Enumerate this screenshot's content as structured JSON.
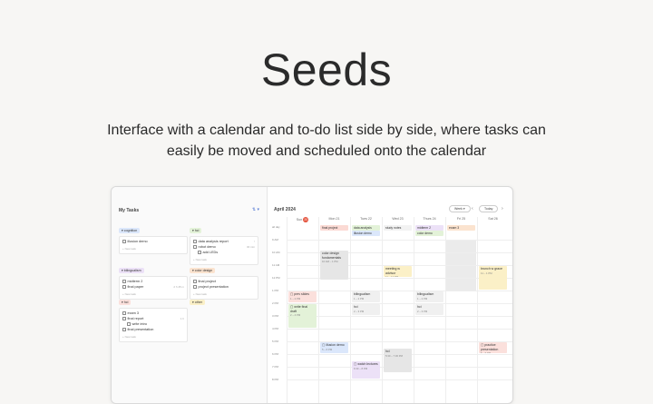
{
  "hero": {
    "title": "Seeds",
    "subtitle": "Interface with a calendar and to-do list side by side, where tasks can easily be moved and scheduled onto the calendar"
  },
  "tasks_panel": {
    "title": "My Tasks",
    "tools": "⇅ ▾",
    "new_task": "+ New task",
    "groups": [
      {
        "id": "cognition",
        "label": "▾ cognition",
        "color": "#dbe7fb",
        "tasks": [
          {
            "text": "illusion demo",
            "meta": "",
            "sub": false
          }
        ]
      },
      {
        "id": "hci",
        "label": "▾ hci",
        "color": "#e3f2d8",
        "tasks": [
          {
            "text": "data analysis report",
            "meta": "!",
            "sub": false
          },
          {
            "text": "robot demo",
            "meta": "30 min",
            "sub": false
          },
          {
            "text": "add LEDs",
            "meta": "",
            "sub": true
          }
        ]
      },
      {
        "id": "bilingualism",
        "label": "▾ bilingualism",
        "color": "#ece1f7",
        "tasks": [
          {
            "text": "midterm 2",
            "meta": "",
            "sub": false
          },
          {
            "text": "final paper",
            "meta": "2 h 45 m",
            "sub": false
          }
        ]
      },
      {
        "id": "color-design",
        "label": "▾ color design",
        "color": "#fbe3cf",
        "tasks": [
          {
            "text": "final project",
            "meta": "",
            "sub": false
          },
          {
            "text": "project presentation",
            "meta": "",
            "sub": false
          }
        ]
      },
      {
        "id": "hci2",
        "label": "▾ hci",
        "color": "#fbe0dc",
        "tasks": [
          {
            "text": "exam 3",
            "meta": "",
            "sub": false
          },
          {
            "text": "final report",
            "meta": "1 h",
            "sub": false
          },
          {
            "text": "write intro",
            "meta": "",
            "sub": true
          },
          {
            "text": "final presentation",
            "meta": "",
            "sub": false
          }
        ]
      },
      {
        "id": "other",
        "label": "▾ other",
        "color": "#fbf0c7",
        "tasks": []
      }
    ]
  },
  "calendar": {
    "month_title": "April 2024",
    "view_button": "Week ▾",
    "today_button": "Today",
    "nav_prev": "‹",
    "nav_next": "›",
    "days": [
      {
        "label": "Sun",
        "num": "20",
        "today": true
      },
      {
        "label": "Mon",
        "num": "21",
        "today": false
      },
      {
        "label": "Tues",
        "num": "22",
        "today": false
      },
      {
        "label": "Wed",
        "num": "23",
        "today": false
      },
      {
        "label": "Thurs",
        "num": "24",
        "today": false
      },
      {
        "label": "Fri",
        "num": "25",
        "today": false
      },
      {
        "label": "Sat",
        "num": "26",
        "today": false
      }
    ],
    "allday_label": "all day",
    "hours": [
      "9 AM",
      "10 AM",
      "11 AM",
      "12 PM",
      "1 PM",
      "2 PM",
      "3 PM",
      "4 PM",
      "5 PM",
      "6 PM",
      "7 PM",
      "8 PM"
    ],
    "allday_events": [
      {
        "day": 1,
        "row": 0,
        "text": "final project",
        "color": "#fbdad4"
      },
      {
        "day": 2,
        "row": 0,
        "text": "data analysis",
        "color": "#e3f2d8"
      },
      {
        "day": 2,
        "row": 1,
        "text": "illusion demo",
        "color": "#dbe7fb"
      },
      {
        "day": 3,
        "row": 0,
        "text": "study notes",
        "color": "#f2f2f2"
      },
      {
        "day": 4,
        "row": 0,
        "text": "midterm 2",
        "color": "#ece1f7"
      },
      {
        "day": 4,
        "row": 1,
        "text": "color demo",
        "color": "#e3f2d8"
      },
      {
        "day": 5,
        "row": 0,
        "text": "exam 3",
        "color": "#fbe3cf"
      }
    ],
    "events": [
      {
        "day": 1,
        "start": 0.8,
        "end": 3.2,
        "title": "color design fundamentals",
        "time": "10 AM – 1 PM",
        "color": "#e6e6e6"
      },
      {
        "day": 3,
        "start": 2.0,
        "end": 3.0,
        "title": "meeting w advisor",
        "time": "11 – 12 PM",
        "color": "#fbf0c7"
      },
      {
        "day": 6,
        "start": 2.0,
        "end": 4.0,
        "title": "brunch w grace",
        "time": "11 – 1 PM",
        "color": "#fbf0c7"
      },
      {
        "day": 0,
        "start": 4.0,
        "end": 5.0,
        "title": "▢ prev slides",
        "time": "1 – 2 PM",
        "color": "#fbe0dc"
      },
      {
        "day": 2,
        "start": 4.0,
        "end": 5.0,
        "title": "bilingualism",
        "time": "1 – 2 PM",
        "color": "#f0f0f0"
      },
      {
        "day": 4,
        "start": 4.0,
        "end": 5.0,
        "title": "bilingualism",
        "time": "1 – 2 PM",
        "color": "#f0f0f0"
      },
      {
        "day": 0,
        "start": 5.0,
        "end": 7.0,
        "title": "▢ write final draft",
        "time": "2 – 4 PM",
        "color": "#e3f2d8"
      },
      {
        "day": 2,
        "start": 5.0,
        "end": 6.0,
        "title": "hci",
        "time": "2 – 3 PM",
        "color": "#f0f0f0"
      },
      {
        "day": 4,
        "start": 5.0,
        "end": 6.0,
        "title": "hci",
        "time": "2 – 3 PM",
        "color": "#f0f0f0"
      },
      {
        "day": 1,
        "start": 8.0,
        "end": 9.0,
        "title": "▢ illusion demo",
        "time": "5 – 6 PM",
        "color": "#dbe7fb"
      },
      {
        "day": 3,
        "start": 8.5,
        "end": 10.5,
        "title": "hci",
        "time": "5:30 – 7:30 PM",
        "color": "#e6e6e6"
      },
      {
        "day": 6,
        "start": 8.0,
        "end": 9.0,
        "title": "▢ practice presentation",
        "time": "5 – 6 PM",
        "color": "#fbe0dc"
      },
      {
        "day": 2,
        "start": 9.5,
        "end": 11.0,
        "title": "▢ watch lectures",
        "time": "6:30 – 8 PM",
        "color": "#ece1f7"
      }
    ],
    "shaded": [
      {
        "day": 5,
        "start": 0.0,
        "end": 4.0
      }
    ]
  }
}
